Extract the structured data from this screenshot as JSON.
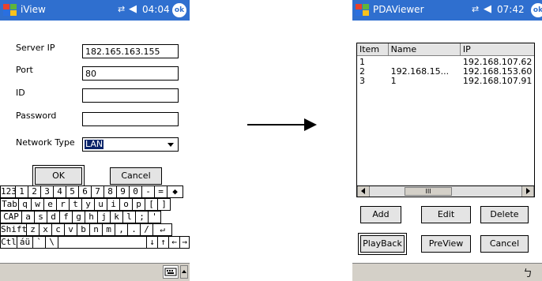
{
  "screen1": {
    "title": "iView",
    "time": "04:04",
    "ok_label": "ok",
    "fields": {
      "server_ip_label": "Server IP",
      "server_ip_value": "182.165.163.155",
      "port_label": "Port",
      "port_value": "80",
      "id_label": "ID",
      "id_value": "",
      "password_label": "Password",
      "password_value": "",
      "network_type_label": "Network Type",
      "network_type_value": "LAN"
    },
    "buttons": {
      "ok": "OK",
      "cancel": "Cancel"
    },
    "keyboard": {
      "rows": [
        [
          "123",
          "1",
          "2",
          "3",
          "4",
          "5",
          "6",
          "7",
          "8",
          "9",
          "0",
          "-",
          "=",
          "◆"
        ],
        [
          "Tab",
          "q",
          "w",
          "e",
          "r",
          "t",
          "y",
          "u",
          "i",
          "o",
          "p",
          "[",
          "]"
        ],
        [
          "CAP",
          "a",
          "s",
          "d",
          "f",
          "g",
          "h",
          "j",
          "k",
          "l",
          ";",
          "'"
        ],
        [
          "Shift",
          "z",
          "x",
          "c",
          "v",
          "b",
          "n",
          "m",
          ",",
          ".",
          "/",
          "↵"
        ],
        [
          "Ctl",
          "áü",
          "`",
          "\\",
          "",
          "↓",
          "↑",
          "←",
          "→"
        ]
      ]
    }
  },
  "screen2": {
    "title": "PDAViewer",
    "time": "07:42",
    "list": {
      "columns": [
        "Item",
        "Name",
        "IP"
      ],
      "rows": [
        [
          "1",
          "",
          "192.168.107.62"
        ],
        [
          "2",
          "192.168.15...",
          "192.168.153.60"
        ],
        [
          "3",
          "1",
          "192.168.107.91"
        ]
      ],
      "scroll_thumb": "III"
    },
    "buttons": {
      "add": "Add",
      "edit": "Edit",
      "delete": "Delete",
      "playback": "PlayBack",
      "preview": "PreView",
      "cancel": "Cancel"
    }
  },
  "colors": {
    "titlebar": "#2f6fcf",
    "selection": "#0a246a"
  }
}
